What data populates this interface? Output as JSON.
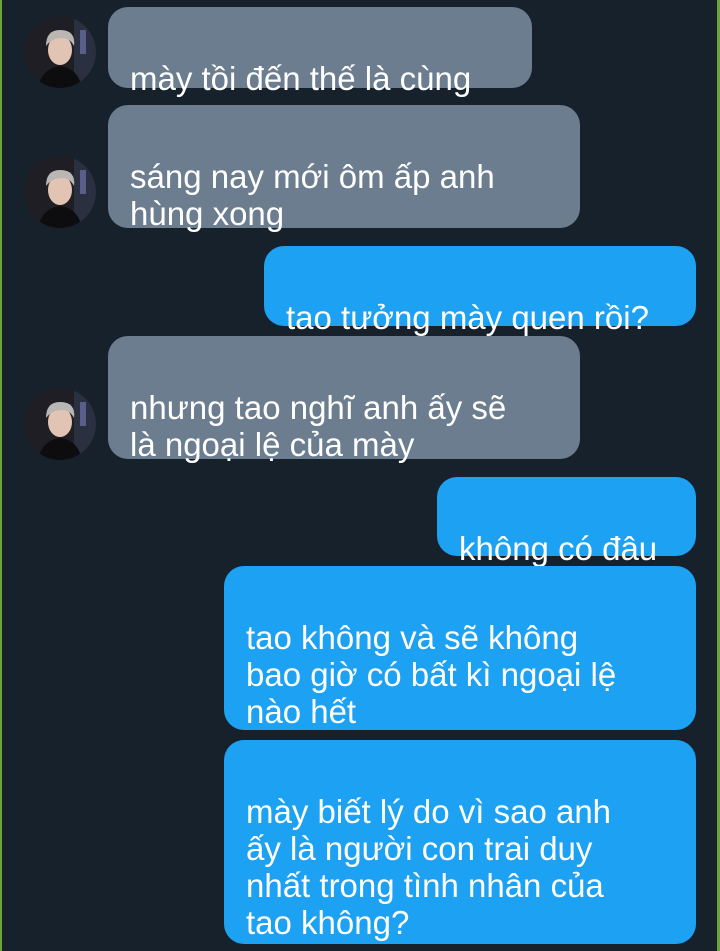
{
  "chat": {
    "messages": [
      {
        "side": "incoming",
        "text": "mày tồi đến thế là cùng"
      },
      {
        "side": "incoming",
        "text": "sáng nay mới ôm ấp anh\nhùng xong"
      },
      {
        "side": "outgoing",
        "text": "tao tưởng mày quen rồi?"
      },
      {
        "side": "incoming",
        "text": "nhưng tao nghĩ anh ấy sẽ\nlà ngoại lệ của mày"
      },
      {
        "side": "outgoing",
        "text": "không có đâu"
      },
      {
        "side": "outgoing",
        "text": "tao không và sẽ không\nbao giờ có bất kì ngoại lệ\nnào hết"
      },
      {
        "side": "outgoing",
        "text": "mày biết lý do vì sao anh\nấy là người con trai duy\nnhất trong tình nhân của\ntao không?"
      }
    ]
  },
  "colors": {
    "background": "#17212b",
    "incoming_bubble": "#6b7d8e",
    "outgoing_bubble": "#1da1f2",
    "frame_edge": "#6aa43a"
  },
  "icons": {
    "avatar": "contact-avatar-photo"
  }
}
